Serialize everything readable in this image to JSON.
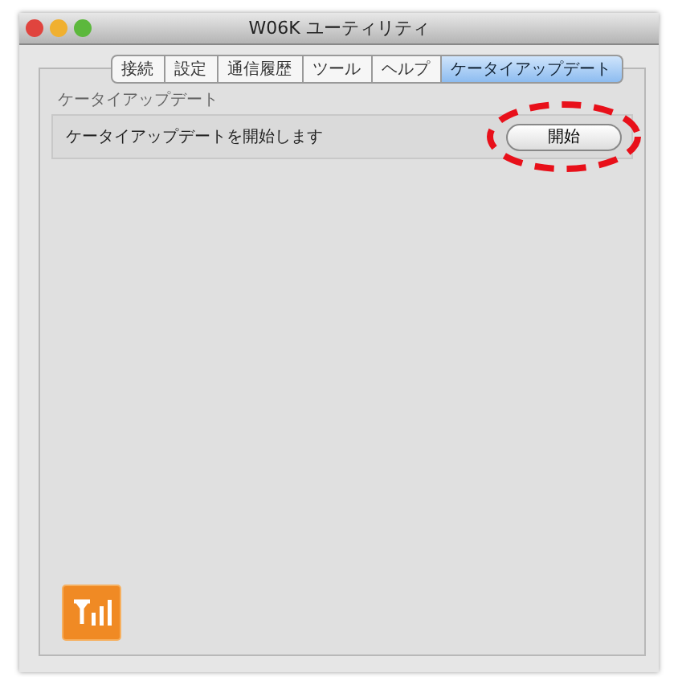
{
  "window": {
    "title": "W06K ユーティリティ"
  },
  "tabs": [
    {
      "label": "接続",
      "selected": false
    },
    {
      "label": "設定",
      "selected": false
    },
    {
      "label": "通信履歴",
      "selected": false
    },
    {
      "label": "ツール",
      "selected": false
    },
    {
      "label": "ヘルプ",
      "selected": false
    },
    {
      "label": "ケータイアップデート",
      "selected": true
    }
  ],
  "section": {
    "title": "ケータイアップデート",
    "message": "ケータイアップデートを開始します",
    "button": "開始",
    "highlighted": true
  }
}
